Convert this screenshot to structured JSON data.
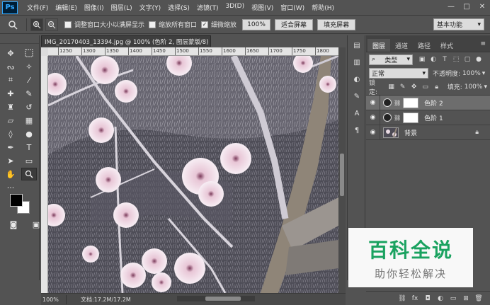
{
  "menubar": {
    "logo": "Ps",
    "items": [
      "文件(F)",
      "编辑(E)",
      "图像(I)",
      "图层(L)",
      "文字(Y)",
      "选择(S)",
      "滤镜(T)",
      "3D(D)",
      "视图(V)",
      "窗口(W)",
      "帮助(H)"
    ],
    "minimize": "—",
    "maximize": "□",
    "close": "✕"
  },
  "options": {
    "resize_windows": "调整窗口大小以满屏显示",
    "zoom_all": "缩放所有窗口",
    "scrubby_zoom": "细微缩放",
    "scrubby_checked": "✓",
    "zoom_value": "100%",
    "fit_screen": "适合屏幕",
    "fill_screen": "填充屏幕",
    "workspace": "基本功能"
  },
  "document": {
    "tab_title": "IMG_20170403_13394.jpg @ 100% (色阶 2, 图层蒙版/8) *",
    "tab_close": "×",
    "ruler_ticks": [
      "1250",
      "1300",
      "1350",
      "1400",
      "1450",
      "1500",
      "1550",
      "1600",
      "1650",
      "1700",
      "1750",
      "1800"
    ],
    "status_zoom": "100%",
    "status_doc": "文档:17.2M/17.2M"
  },
  "layers_panel": {
    "tabs": [
      "图层",
      "通道",
      "路径",
      "样式"
    ],
    "active_tab": "图层",
    "filter_kind": "类型",
    "blend_mode": "正常",
    "opacity_label": "不透明度:",
    "opacity_value": "100%",
    "lock_label": "锁定:",
    "fill_label": "填充:",
    "fill_value": "100%",
    "layers": [
      {
        "name": "色阶 2",
        "type": "adjustment",
        "selected": true
      },
      {
        "name": "色阶 1",
        "type": "adjustment",
        "selected": false
      },
      {
        "name": "背景",
        "type": "image",
        "selected": false
      }
    ]
  },
  "watermark": {
    "title": "百科全说",
    "subtitle": "助你轻松解决"
  }
}
